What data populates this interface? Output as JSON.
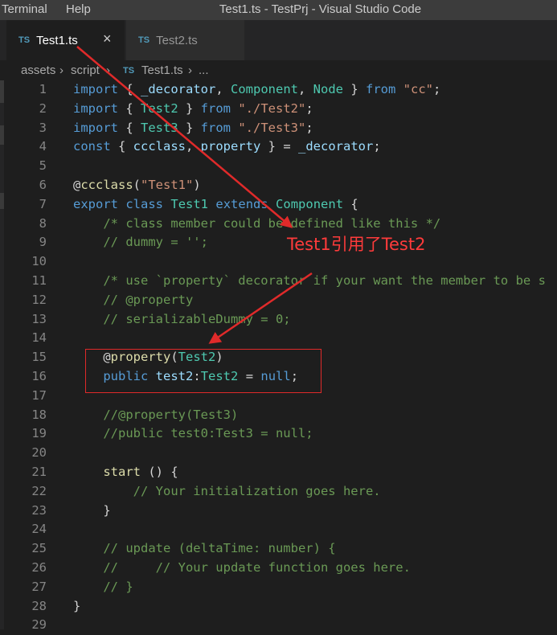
{
  "window": {
    "menu": [
      "Terminal",
      "Help"
    ],
    "title": "Test1.ts - TestPrj - Visual Studio Code"
  },
  "tabs": [
    {
      "badge": "TS",
      "label": "Test1.ts",
      "close": "×",
      "active": true
    },
    {
      "badge": "TS",
      "label": "Test2.ts",
      "active": false
    }
  ],
  "breadcrumb": {
    "items": [
      "assets",
      "script",
      "Test1.ts",
      "..."
    ],
    "file_badge": "TS"
  },
  "annotation": {
    "text": "Test1引用了Test2",
    "color": "#ff3b3b"
  },
  "colors": {
    "keyword": "#569cd6",
    "type": "#4ec9b0",
    "string": "#ce9178",
    "comment": "#6a9955",
    "function": "#dcdcaa",
    "variable": "#9cdcfe",
    "plain": "#d4d4d4"
  },
  "code_lines": [
    {
      "n": "1",
      "tokens": [
        [
          "kw",
          "import"
        ],
        [
          "pl",
          " { "
        ],
        [
          "id",
          "_decorator"
        ],
        [
          "pl",
          ", "
        ],
        [
          "ty",
          "Component"
        ],
        [
          "pl",
          ", "
        ],
        [
          "ty",
          "Node"
        ],
        [
          "pl",
          " } "
        ],
        [
          "kw",
          "from"
        ],
        [
          "pl",
          " "
        ],
        [
          "st",
          "\"cc\""
        ],
        [
          "pl",
          ";"
        ]
      ]
    },
    {
      "n": "2",
      "tokens": [
        [
          "kw",
          "import"
        ],
        [
          "pl",
          " { "
        ],
        [
          "ty",
          "Test2"
        ],
        [
          "pl",
          " } "
        ],
        [
          "kw",
          "from"
        ],
        [
          "pl",
          " "
        ],
        [
          "st",
          "\"./Test2\""
        ],
        [
          "pl",
          ";"
        ]
      ]
    },
    {
      "n": "3",
      "tokens": [
        [
          "kw",
          "import"
        ],
        [
          "pl",
          " { "
        ],
        [
          "ty",
          "Test3"
        ],
        [
          "pl",
          " } "
        ],
        [
          "kw",
          "from"
        ],
        [
          "pl",
          " "
        ],
        [
          "st",
          "\"./Test3\""
        ],
        [
          "pl",
          ";"
        ]
      ]
    },
    {
      "n": "4",
      "tokens": [
        [
          "kw",
          "const"
        ],
        [
          "pl",
          " { "
        ],
        [
          "id",
          "ccclass"
        ],
        [
          "pl",
          ", "
        ],
        [
          "id",
          "property"
        ],
        [
          "pl",
          " } = "
        ],
        [
          "id",
          "_decorator"
        ],
        [
          "pl",
          ";"
        ]
      ]
    },
    {
      "n": "5",
      "tokens": []
    },
    {
      "n": "6",
      "tokens": [
        [
          "pl",
          "@"
        ],
        [
          "fn",
          "ccclass"
        ],
        [
          "pl",
          "("
        ],
        [
          "st",
          "\"Test1\""
        ],
        [
          "pl",
          ")"
        ]
      ]
    },
    {
      "n": "7",
      "tokens": [
        [
          "kw",
          "export"
        ],
        [
          "pl",
          " "
        ],
        [
          "kw",
          "class"
        ],
        [
          "pl",
          " "
        ],
        [
          "ty",
          "Test1"
        ],
        [
          "pl",
          " "
        ],
        [
          "kw",
          "extends"
        ],
        [
          "pl",
          " "
        ],
        [
          "ty",
          "Component"
        ],
        [
          "pl",
          " {"
        ]
      ]
    },
    {
      "n": "8",
      "tokens": [
        [
          "pl",
          "    "
        ],
        [
          "cm",
          "/* class member could be defined like this */"
        ]
      ]
    },
    {
      "n": "9",
      "tokens": [
        [
          "pl",
          "    "
        ],
        [
          "cm",
          "// dummy = '';"
        ]
      ]
    },
    {
      "n": "10",
      "tokens": []
    },
    {
      "n": "11",
      "tokens": [
        [
          "pl",
          "    "
        ],
        [
          "cm",
          "/* use `property` decorator if your want the member to be s"
        ]
      ]
    },
    {
      "n": "12",
      "tokens": [
        [
          "pl",
          "    "
        ],
        [
          "cm",
          "// @property"
        ]
      ]
    },
    {
      "n": "13",
      "tokens": [
        [
          "pl",
          "    "
        ],
        [
          "cm",
          "// serializableDummy = 0;"
        ]
      ]
    },
    {
      "n": "14",
      "tokens": []
    },
    {
      "n": "15",
      "tokens": [
        [
          "pl",
          "    @"
        ],
        [
          "fn",
          "property"
        ],
        [
          "pl",
          "("
        ],
        [
          "ty",
          "Test2"
        ],
        [
          "pl",
          ")"
        ]
      ]
    },
    {
      "n": "16",
      "tokens": [
        [
          "pl",
          "    "
        ],
        [
          "kw",
          "public"
        ],
        [
          "pl",
          " "
        ],
        [
          "id",
          "test2"
        ],
        [
          "pl",
          ":"
        ],
        [
          "ty",
          "Test2"
        ],
        [
          "pl",
          " = "
        ],
        [
          "kw",
          "null"
        ],
        [
          "pl",
          ";"
        ]
      ]
    },
    {
      "n": "17",
      "tokens": []
    },
    {
      "n": "18",
      "tokens": [
        [
          "pl",
          "    "
        ],
        [
          "cm",
          "//@property(Test3)"
        ]
      ]
    },
    {
      "n": "19",
      "tokens": [
        [
          "pl",
          "    "
        ],
        [
          "cm",
          "//public test0:Test3 = null;"
        ]
      ]
    },
    {
      "n": "20",
      "tokens": []
    },
    {
      "n": "21",
      "tokens": [
        [
          "pl",
          "    "
        ],
        [
          "fn",
          "start"
        ],
        [
          "pl",
          " () {"
        ]
      ]
    },
    {
      "n": "22",
      "tokens": [
        [
          "pl",
          "        "
        ],
        [
          "cm",
          "// Your initialization goes here."
        ]
      ]
    },
    {
      "n": "23",
      "tokens": [
        [
          "pl",
          "    }"
        ]
      ]
    },
    {
      "n": "24",
      "tokens": []
    },
    {
      "n": "25",
      "tokens": [
        [
          "pl",
          "    "
        ],
        [
          "cm",
          "// update (deltaTime: number) {"
        ]
      ]
    },
    {
      "n": "26",
      "tokens": [
        [
          "pl",
          "    "
        ],
        [
          "cm",
          "//     // Your update function goes here."
        ]
      ]
    },
    {
      "n": "27",
      "tokens": [
        [
          "pl",
          "    "
        ],
        [
          "cm",
          "// }"
        ]
      ]
    },
    {
      "n": "28",
      "tokens": [
        [
          "pl",
          "}"
        ]
      ]
    },
    {
      "n": "29",
      "tokens": []
    }
  ]
}
